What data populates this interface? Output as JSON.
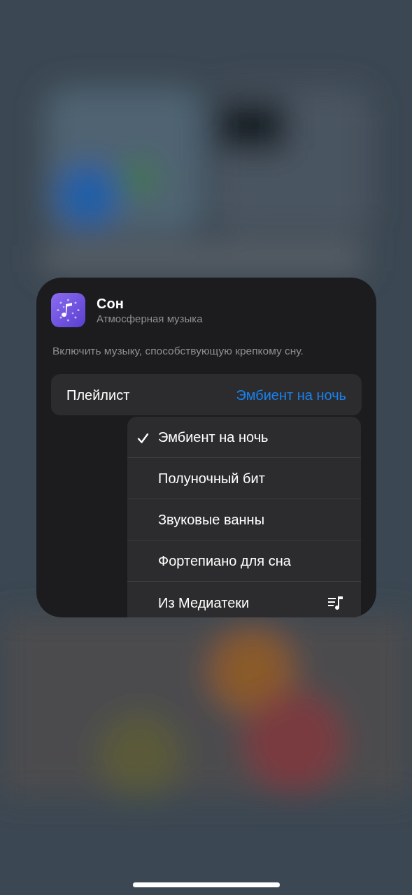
{
  "shortcut": {
    "title": "Сон",
    "subtitle": "Атмосферная музыка",
    "description": "Включить музыку, способствующую крепкому сну."
  },
  "parameter": {
    "label": "Плейлист",
    "value": "Эмбиент на ночь"
  },
  "menu": [
    {
      "label": "Эмбиент на ночь",
      "selected": true,
      "kind": "option"
    },
    {
      "label": "Полуночный бит",
      "selected": false,
      "kind": "option"
    },
    {
      "label": "Звуковые ванны",
      "selected": false,
      "kind": "option"
    },
    {
      "label": "Фортепиано для сна",
      "selected": false,
      "kind": "option"
    },
    {
      "label": "Из Медиатеки",
      "selected": false,
      "kind": "library"
    }
  ]
}
